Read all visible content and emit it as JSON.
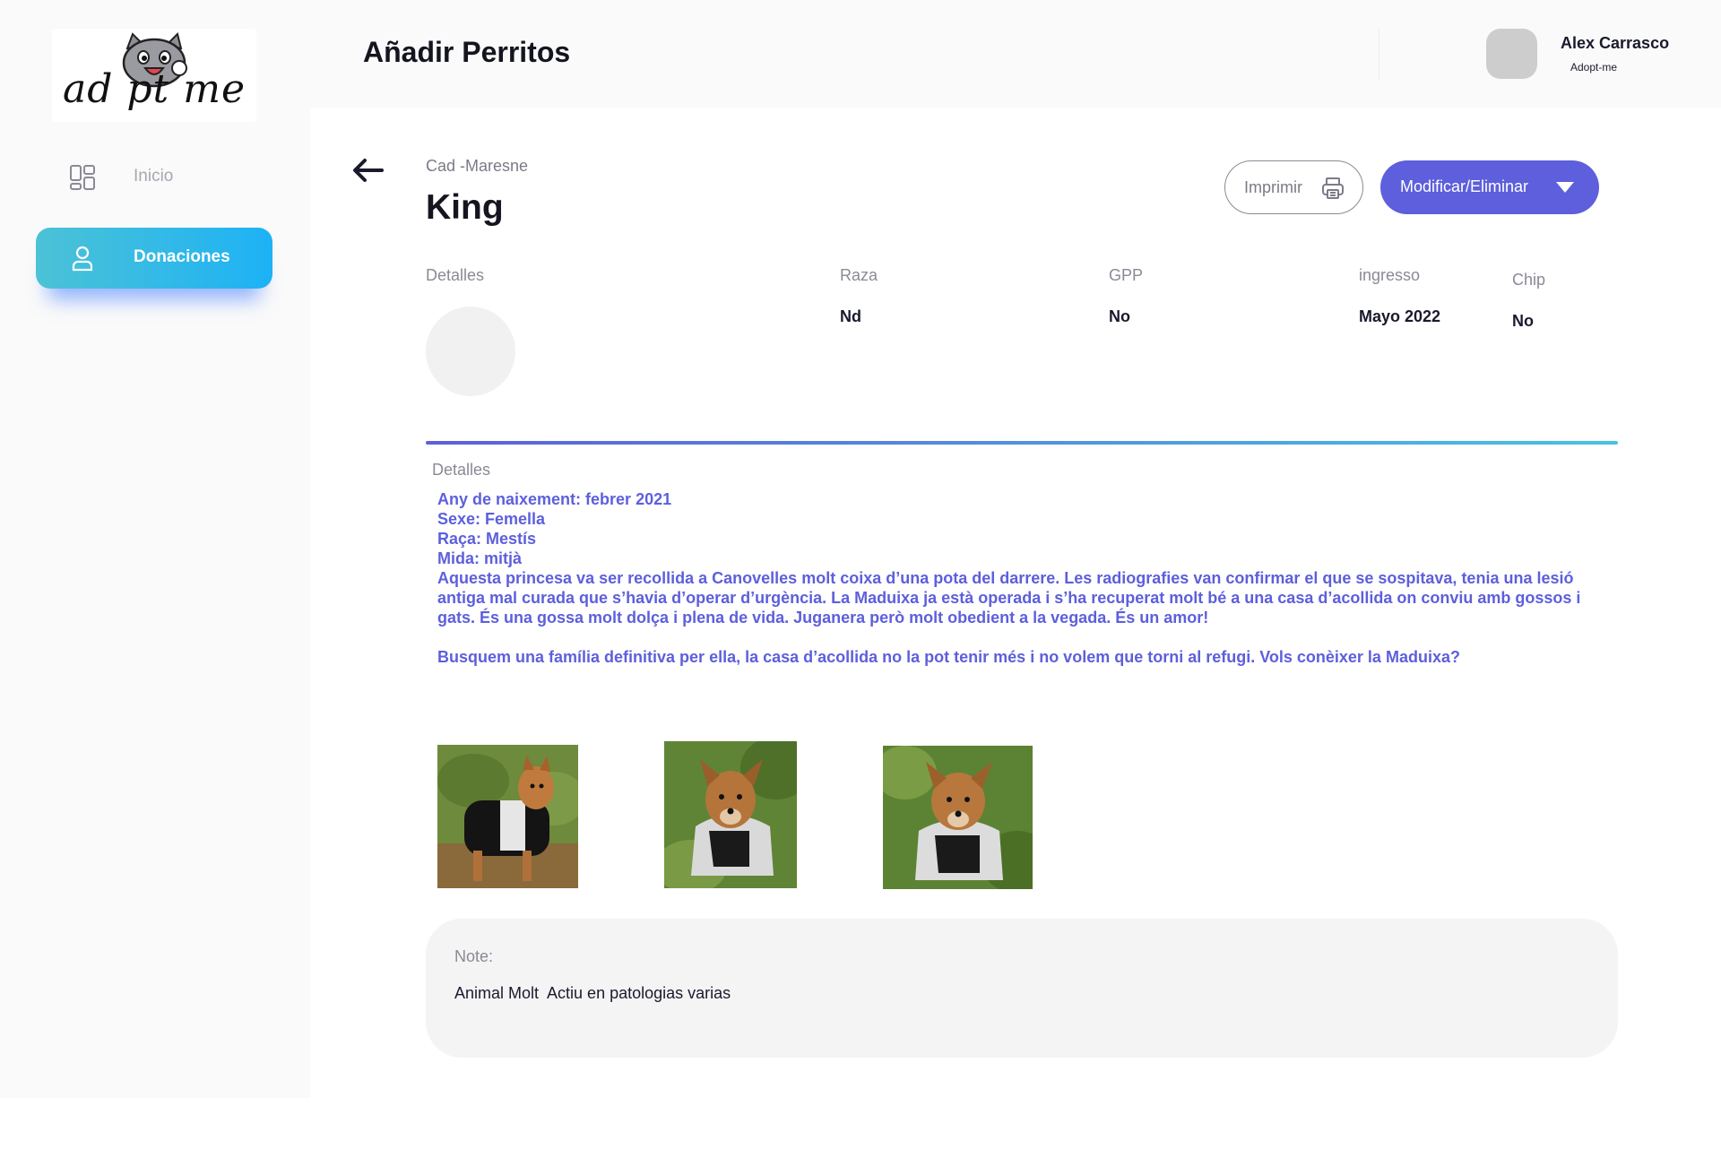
{
  "app": {
    "logo_text": "ad   pt   me",
    "page_title": "Añadir Perritos"
  },
  "sidebar": {
    "items": [
      {
        "label": "Inicio",
        "icon": "dashboard-icon",
        "active": false
      },
      {
        "label": "Donaciones",
        "icon": "user-icon",
        "active": true
      }
    ]
  },
  "user": {
    "name": "Alex Carrasco",
    "subtitle": "Adopt-me"
  },
  "pet": {
    "breadcrumb": "Cad -Maresne",
    "name": "King"
  },
  "actions": {
    "print_label": "Imprimir",
    "modify_label": "Modificar/Eliminar"
  },
  "fields": {
    "detalles_label": "Detalles",
    "raza_label": "Raza",
    "raza_value": "Nd",
    "gpp_label": "GPP",
    "gpp_value": "No",
    "ingreso_label": "ingresso",
    "ingreso_value": "Mayo 2022",
    "chip_label": "Chip",
    "chip_value": "No"
  },
  "description": {
    "label": "Detalles",
    "line1": "Any de naixement: febrer 2021",
    "line2": "Sexe: Femella",
    "line3": "Raça: Mestís",
    "line4": "Mida: mitjà",
    "paragraph1": "Aquesta princesa va ser recollida a Canovelles molt coixa d’una pota del darrere. Les radiografies van confirmar el que se sospitava, tenia una lesió antiga mal curada que s’havia d’operar d’urgència. La Maduixa ja està operada i s’ha recuperat molt bé a una casa d’acollida on conviu amb gossos i gats. És una gossa molt dolça i plena de vida. Juganera però molt obedient a la vegada. És un amor!",
    "paragraph2": "Busquem una família definitiva per ella, la casa d’acollida no la pot tenir més i no volem que torni al refugi. Vols conèixer la Maduixa?"
  },
  "note": {
    "label": "Note:",
    "text": "Animal Molt  Actiu en patologias varias"
  },
  "colors": {
    "primary": "#5d5fdc",
    "accent_start": "#4cc2d6",
    "accent_end": "#1db2f5"
  }
}
